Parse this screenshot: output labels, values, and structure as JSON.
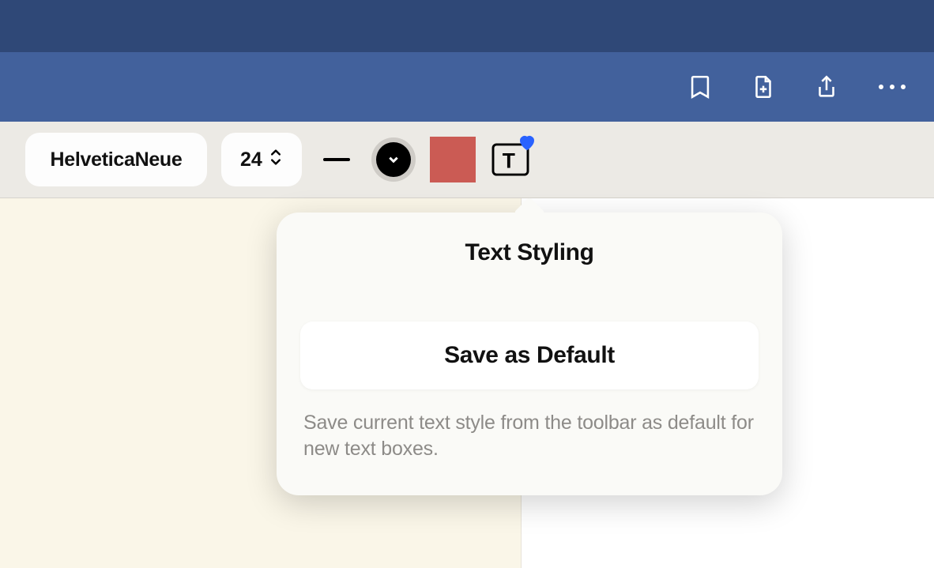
{
  "toolbar": {
    "font_name": "HelveticaNeue",
    "font_size": "24",
    "text_color": "#cb5b54"
  },
  "popover": {
    "title": "Text Styling",
    "save_button": "Save as Default",
    "description": "Save current text style from the toolbar as default for new text boxes."
  }
}
